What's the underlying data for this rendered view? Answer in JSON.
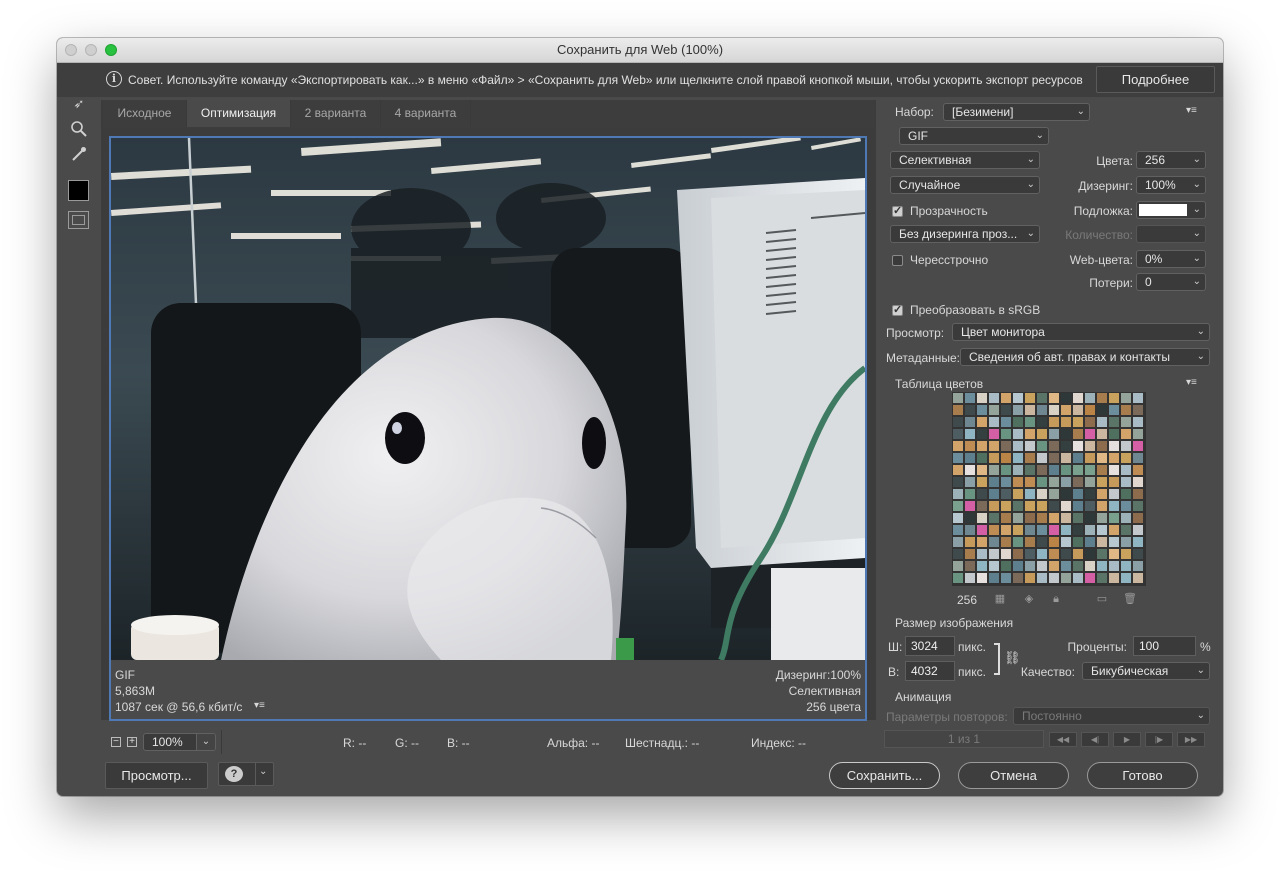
{
  "window": {
    "title": "Сохранить для Web (100%)"
  },
  "tip": {
    "text": "Совет. Используйте команду «Экспортировать как...» в меню «Файл» > «Сохранить для Web» или щелкните слой правой кнопкой мыши, чтобы ускорить экспорт ресурсов",
    "more_button": "Подробнее"
  },
  "tabs": [
    "Исходное",
    "Оптимизация",
    "2 варианта",
    "4 варианта"
  ],
  "active_tab": "Оптимизация",
  "preview_info": {
    "format": "GIF",
    "size": "5,863M",
    "time": "1087 сек @ 56,6 кбит/с",
    "dither": "Дизеринг:100%",
    "palette": "Селективная",
    "colors": "256 цвета"
  },
  "status": {
    "zoom": "100%",
    "r": "R: --",
    "g": "G: --",
    "b": "B: --",
    "alpha": "Альфа: --",
    "hex": "Шестнадц.: --",
    "index": "Индекс: --"
  },
  "settings": {
    "preset_label": "Набор:",
    "preset_value": "[Безимени]",
    "format": "GIF",
    "reduction": "Селективная",
    "colors_label": "Цвета:",
    "colors_value": "256",
    "dither_algo": "Случайное",
    "dither_label": "Дизеринг:",
    "dither_value": "100%",
    "transparency_label": "Прозрачность",
    "transparency_checked": true,
    "matte_label": "Подложка:",
    "matte_color": "#ffffff",
    "transp_dither": "Без дизеринга проз...",
    "amount_label": "Количество:",
    "interlaced_label": "Чересстрочно",
    "interlaced_checked": false,
    "websnap_label": "Web-цвета:",
    "websnap_value": "0%",
    "lossy_label": "Потери:",
    "lossy_value": "0",
    "srgb_label": "Преобразовать в sRGB",
    "srgb_checked": true,
    "preview_label": "Просмотр:",
    "preview_value": "Цвет монитора",
    "metadata_label": "Метаданные:",
    "metadata_value": "Сведения об авт. правах и контакты"
  },
  "color_table": {
    "title": "Таблица цветов",
    "count": "256",
    "palette": [
      "#5d7f8e",
      "#8aa0a6",
      "#c9a25e",
      "#d8d1c5",
      "#6a9482",
      "#3e4a4c",
      "#b98446",
      "#a9bbc4",
      "#7b6a5a",
      "#e1d7cf",
      "#4f6f5f",
      "#c69a5a",
      "#8fb4c2",
      "#2f3838",
      "#d2a46a",
      "#95a49a",
      "#b7c7d0",
      "#6c8d9b",
      "#e0b885",
      "#4e5d62",
      "#d45fa5",
      "#a87d4e",
      "#7aa08e",
      "#c3c8cc",
      "#34403f",
      "#9db1b8",
      "#bf8c53",
      "#e6e1de",
      "#5a7568",
      "#8c6c4c",
      "#cbb79f",
      "#6e8790"
    ]
  },
  "image_size": {
    "title": "Размер изображения",
    "w_label": "Ш:",
    "w_value": "3024",
    "w_unit": "пикс.",
    "h_label": "В:",
    "h_value": "4032",
    "h_unit": "пикс.",
    "percent_label": "Проценты:",
    "percent_value": "100",
    "percent_unit": "%",
    "quality_label": "Качество:",
    "quality_value": "Бикубическая"
  },
  "animation": {
    "title": "Анимация",
    "loop_label": "Параметры повторов:",
    "loop_value": "Постоянно",
    "frame": "1 из 1"
  },
  "buttons": {
    "preview": "Просмотр...",
    "save": "Сохранить...",
    "cancel": "Отмена",
    "done": "Готово"
  }
}
